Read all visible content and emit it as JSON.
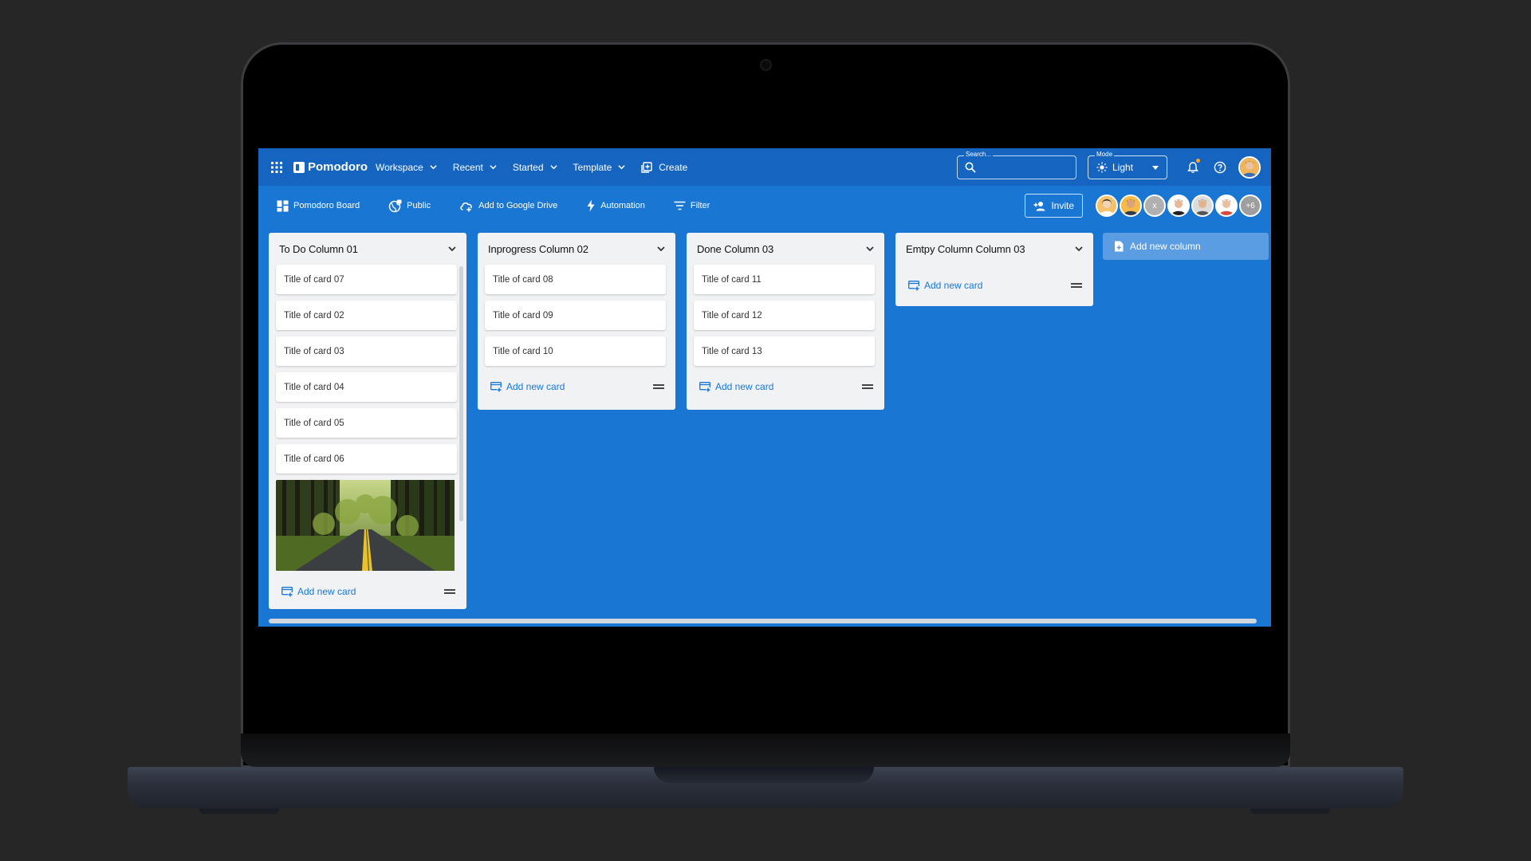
{
  "app": {
    "logo": "Pomodoro",
    "nav": [
      {
        "label": "Workspace"
      },
      {
        "label": "Recent"
      },
      {
        "label": "Started"
      },
      {
        "label": "Template"
      }
    ],
    "create_label": "Create",
    "search": {
      "label": "Search...",
      "value": "",
      "placeholder": ""
    },
    "mode": {
      "label": "Mode",
      "value": "Light"
    }
  },
  "toolbar": {
    "board_label": "Pomodoro Board",
    "public_label": "Public",
    "drive_label": "Add to Google Drive",
    "automation_label": "Automation",
    "filter_label": "Filter",
    "invite_label": "Invite",
    "avatar_initial": "x",
    "more_members": "+6"
  },
  "columns": [
    {
      "title": "To Do Column 01",
      "cards": [
        "Title of card 07",
        "Title of card 02",
        "Title of card 03",
        "Title of card 04",
        "Title of card 05",
        "Title of card 06"
      ],
      "add_label": "Add new card"
    },
    {
      "title": "Inprogress Column 02",
      "cards": [
        "Title of card 08",
        "Title of card 09",
        "Title of card 10"
      ],
      "add_label": "Add new card"
    },
    {
      "title": "Done Column 03",
      "cards": [
        "Title of card 11",
        "Title of card 12",
        "Title of card 13"
      ],
      "add_label": "Add new card"
    },
    {
      "title": "Emtpy Column Column 03",
      "cards": [],
      "add_label": "Add new card"
    }
  ],
  "add_column_label": "Add new column",
  "colors": {
    "appbar": "#1565c0",
    "board": "#1976d2",
    "column": "#f1f2f4",
    "accent": "#1976d2",
    "notification_dot": "#ffa726"
  }
}
